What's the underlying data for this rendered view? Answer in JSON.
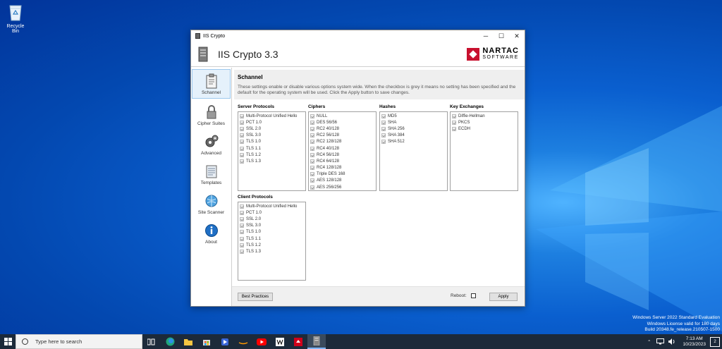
{
  "desktop": {
    "recycle_bin_label": "Recycle Bin"
  },
  "window": {
    "title": "IIS Crypto",
    "app_title": "IIS Crypto 3.3",
    "brand_top": "NARTAC",
    "brand_bottom": "SOFTWARE",
    "controls": {
      "minimize": "─",
      "maximize": "☐",
      "close": "✕"
    }
  },
  "sidebar": [
    {
      "label": "Schannel",
      "icon": "clipboard-icon"
    },
    {
      "label": "Cipher Suites",
      "icon": "lock-icon"
    },
    {
      "label": "Advanced",
      "icon": "gears-icon"
    },
    {
      "label": "Templates",
      "icon": "templates-icon"
    },
    {
      "label": "Site Scanner",
      "icon": "globe-icon"
    },
    {
      "label": "About",
      "icon": "info-icon"
    }
  ],
  "schannel": {
    "heading": "Schannel",
    "description": "These settings enable or disable various options system wide. When the checkbox is grey it means no setting has been specified and the default for the operating system will be used. Click the Apply button to save changes.",
    "server_protocols": {
      "label": "Server Protocols",
      "items": [
        "Multi-Protocol Unified Hello",
        "PCT 1.0",
        "SSL 2.0",
        "SSL 3.0",
        "TLS 1.0",
        "TLS 1.1",
        "TLS 1.2",
        "TLS 1.3"
      ]
    },
    "ciphers": {
      "label": "Ciphers",
      "items": [
        "NULL",
        "DES 56/56",
        "RC2 40/128",
        "RC2 56/128",
        "RC2 128/128",
        "RC4 40/128",
        "RC4 56/128",
        "RC4 64/128",
        "RC4 128/128",
        "Triple DES 168",
        "AES 128/128",
        "AES 256/256"
      ]
    },
    "hashes": {
      "label": "Hashes",
      "items": [
        "MD5",
        "SHA",
        "SHA 256",
        "SHA 384",
        "SHA 512"
      ]
    },
    "key_exchanges": {
      "label": "Key Exchanges",
      "items": [
        "Diffie-Hellman",
        "PKCS",
        "ECDH"
      ]
    },
    "client_protocols": {
      "label": "Client Protocols",
      "items": [
        "Multi-Protocol Unified Hello",
        "PCT 1.0",
        "SSL 2.0",
        "SSL 3.0",
        "TLS 1.0",
        "TLS 1.1",
        "TLS 1.2",
        "TLS 1.3"
      ]
    }
  },
  "footer": {
    "best_practices": "Best Practices",
    "reboot_label": "Reboot:",
    "apply": "Apply"
  },
  "watermark": {
    "line1": "Windows Server 2022 Standard Evaluation",
    "line2": "Windows License valid for 180 days",
    "line3": "Build 20348.fe_release.210507-1500"
  },
  "taskbar": {
    "search_placeholder": "Type here to search",
    "time": "7:13 AM",
    "date": "10/23/2023",
    "notification_count": "2"
  }
}
